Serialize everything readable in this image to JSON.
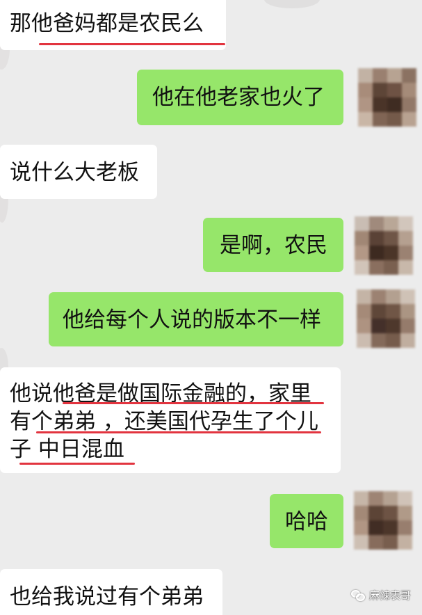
{
  "app": "WeChat",
  "messages": [
    {
      "side": "in",
      "text": "那他爸妈都是农民么"
    },
    {
      "side": "out",
      "text": "他在他老家也火了"
    },
    {
      "side": "in",
      "text": "说什么大老板"
    },
    {
      "side": "out",
      "text": "是啊，农民"
    },
    {
      "side": "out",
      "text": "他给每个人说的版本不一样"
    },
    {
      "side": "in",
      "lines": [
        "他说他爸是做国际金融的，家里",
        "有个弟弟 ，还美国代孕生了个儿",
        "子 中日混血"
      ]
    },
    {
      "side": "out",
      "text": "哈哈"
    },
    {
      "side": "in",
      "text": "也给我说过有个弟弟"
    }
  ],
  "watermark": {
    "text": "麻辣表哥",
    "icon": "wechat-logo-icon"
  },
  "colors": {
    "background": "#ececec",
    "incoming_bubble": "#ffffff",
    "outgoing_bubble": "#96e66a",
    "underline": "#e2343f"
  }
}
